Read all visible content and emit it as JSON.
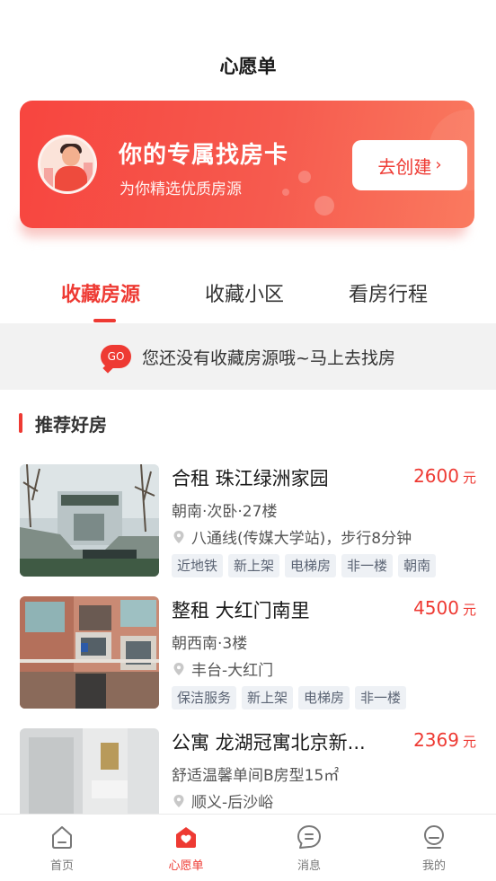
{
  "page": {
    "title": "心愿单"
  },
  "promo": {
    "title": "你的专属找房卡",
    "subtitle": "为你精选优质房源",
    "button_label": "去创建",
    "accent": "#ee3a33"
  },
  "tabs": [
    {
      "label": "收藏房源",
      "active": true
    },
    {
      "label": "收藏小区",
      "active": false
    },
    {
      "label": "看房行程",
      "active": false
    }
  ],
  "empty_state": {
    "badge": "GO",
    "text": "您还没有收藏房源哦~马上去找房"
  },
  "section": {
    "title": "推荐好房"
  },
  "listings": [
    {
      "title": "合租 珠江绿洲家园",
      "price": "2600",
      "unit": "元",
      "desc": "朝南·次卧·27楼",
      "location": "八通线(传媒大学站)，步行8分钟",
      "tags": [
        "近地铁",
        "新上架",
        "电梯房",
        "非一楼",
        "朝南"
      ]
    },
    {
      "title": "整租 大红门南里",
      "price": "4500",
      "unit": "元",
      "desc": "朝西南·3楼",
      "location": "丰台-大红门",
      "tags": [
        "保洁服务",
        "新上架",
        "电梯房",
        "非一楼"
      ]
    },
    {
      "title": "公寓 龙湖冠寓北京新...",
      "price": "2369",
      "unit": "元",
      "desc": "舒适温馨单间B房型15㎡",
      "location": "顺义-后沙峪",
      "tags": []
    }
  ],
  "tabbar": [
    {
      "label": "首页",
      "icon": "home-icon",
      "active": false
    },
    {
      "label": "心愿单",
      "icon": "wishlist-heart-icon",
      "active": true
    },
    {
      "label": "消息",
      "icon": "message-icon",
      "active": false
    },
    {
      "label": "我的",
      "icon": "profile-icon",
      "active": false
    }
  ]
}
